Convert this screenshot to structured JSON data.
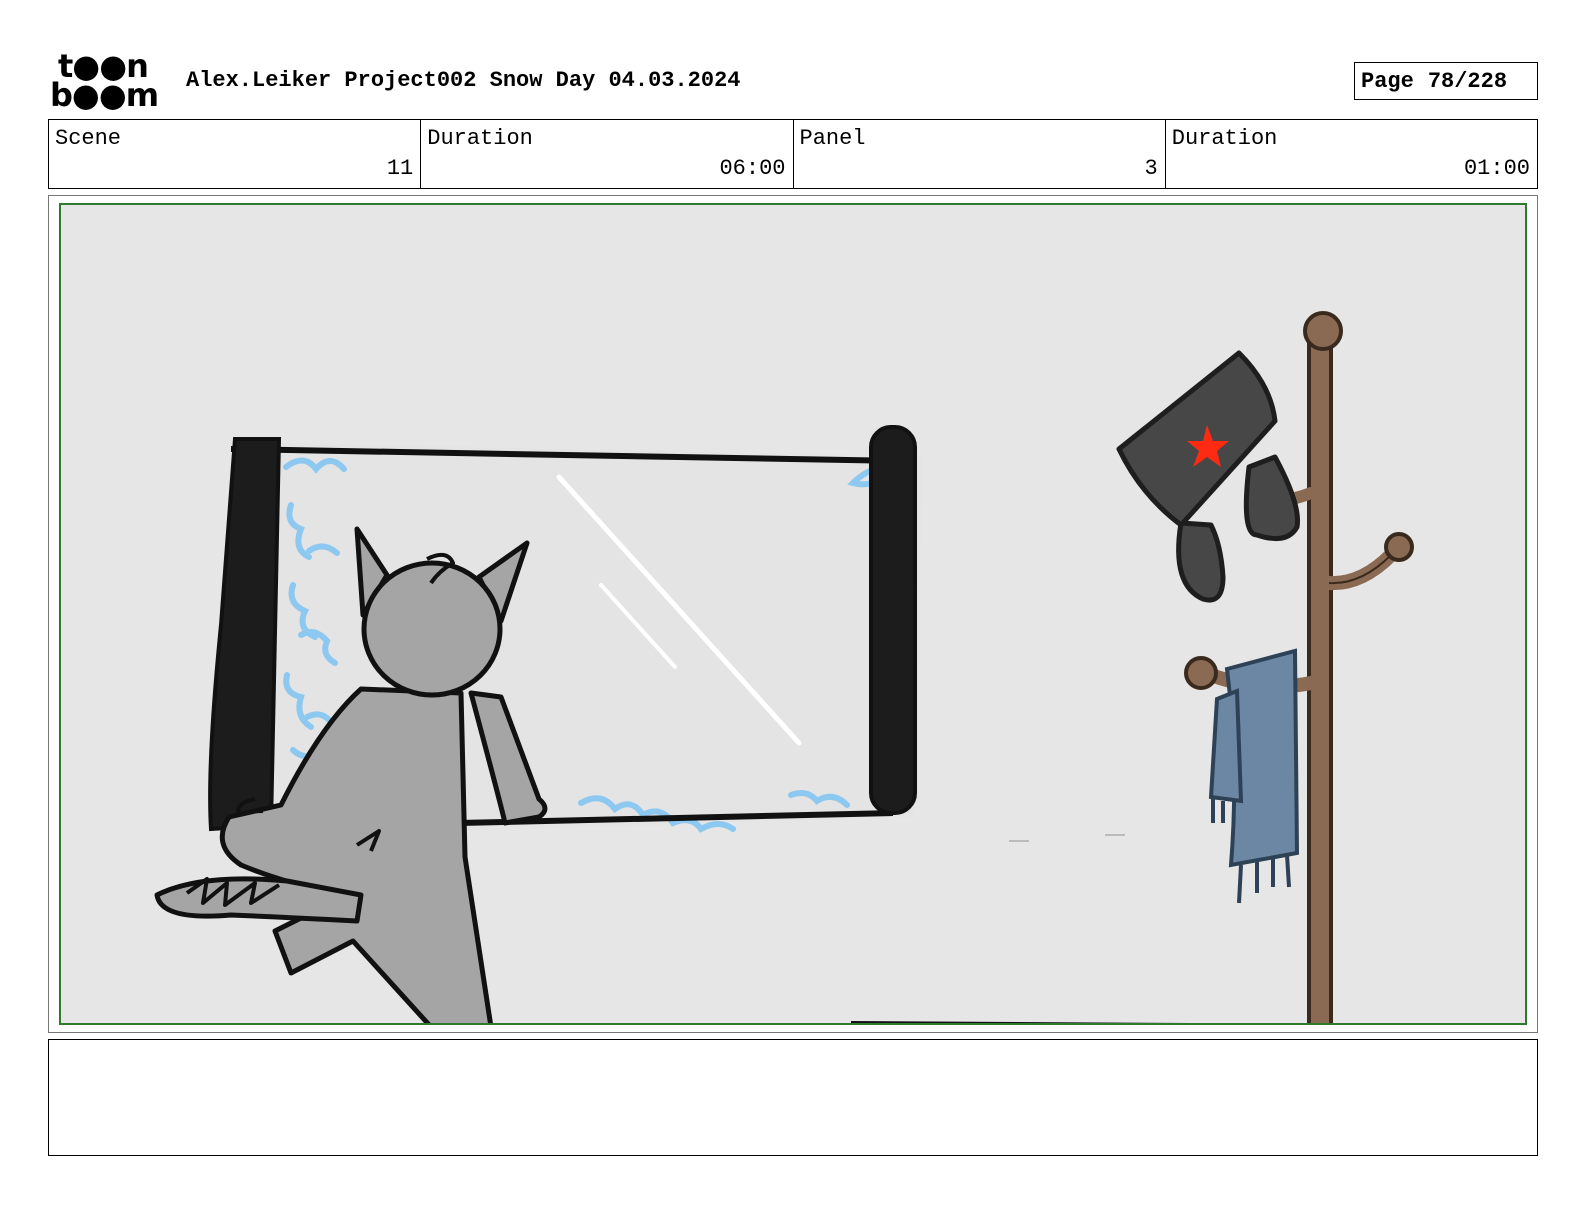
{
  "header": {
    "logo_line_1": "t●●n",
    "logo_line_2": "b●●m",
    "title": "Alex.Leiker Project002 Snow Day 04.03.2024",
    "page_label": "Page",
    "page_number": "78/228"
  },
  "info": {
    "scene_label": "Scene",
    "scene_value": "11",
    "scene_duration_label": "Duration",
    "scene_duration_value": "06:00",
    "panel_label": "Panel",
    "panel_value": "3",
    "panel_duration_label": "Duration",
    "panel_duration_value": "01:00"
  },
  "notes": "",
  "colors": {
    "panel_border": "#2f7a2f",
    "panel_background": "#e6e6e6",
    "frost": "#8cc8f0",
    "cat_fur": "#a5a5a5",
    "coat_rack_wood": "#8a6a52",
    "hat": "#474747",
    "hat_star": "#ff2a12",
    "scarf": "#6b87a3"
  }
}
